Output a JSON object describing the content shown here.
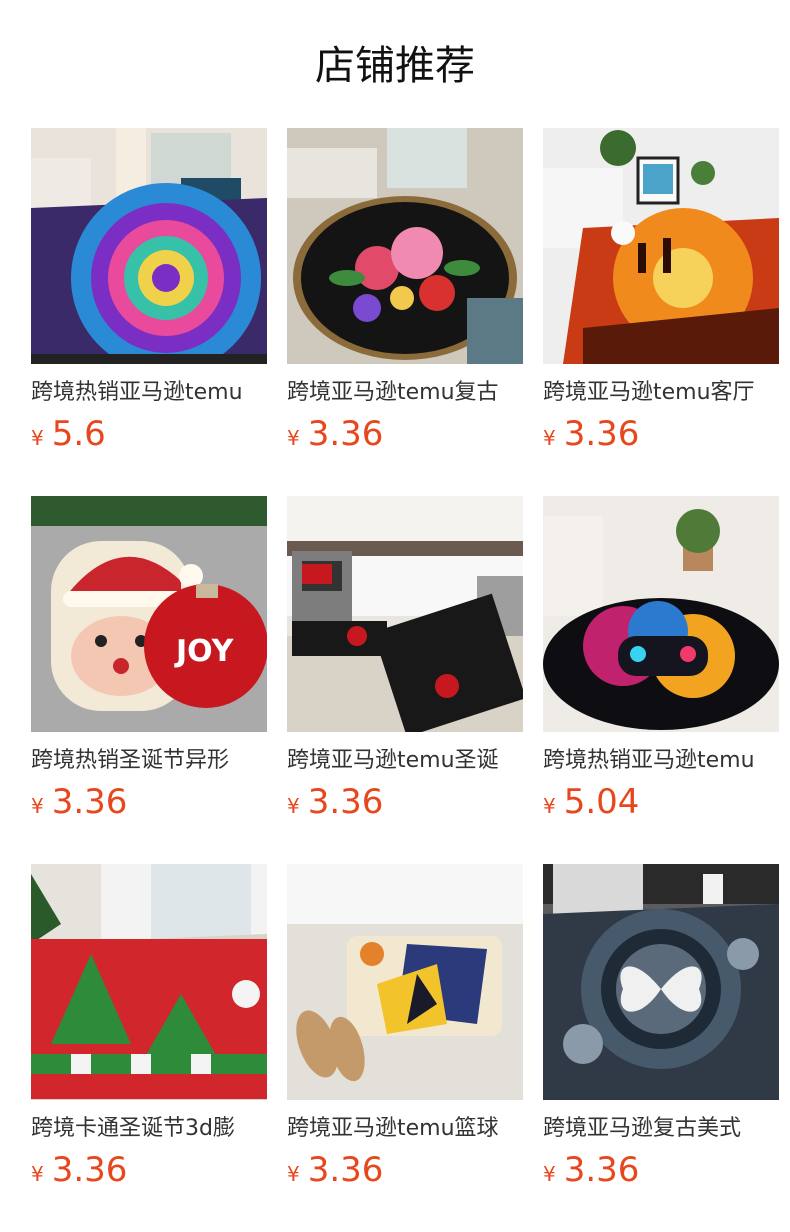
{
  "header": {
    "title": "店铺推荐"
  },
  "currency_symbol": "¥",
  "colors": {
    "price": "#e8461d",
    "text": "#333333"
  },
  "products": [
    {
      "name": "跨境热销亚马逊temu",
      "price": "5.6",
      "image": "psychedelic-mandala-rug"
    },
    {
      "name": "跨境亚马逊temu复古",
      "price": "3.36",
      "image": "floral-oval-rug"
    },
    {
      "name": "跨境亚马逊temu客厅",
      "price": "3.36",
      "image": "western-sunset-rug"
    },
    {
      "name": "跨境热销圣诞节异形",
      "price": "3.36",
      "image": "santa-joy-ornament-mats"
    },
    {
      "name": "跨境亚马逊temu圣诞",
      "price": "3.36",
      "image": "christmas-kitchen-runners"
    },
    {
      "name": "跨境热销亚马逊temu",
      "price": "5.04",
      "image": "gamepad-round-rug"
    },
    {
      "name": "跨境卡通圣诞节3d膨",
      "price": "3.36",
      "image": "merry-christmas-door-mat"
    },
    {
      "name": "跨境亚马逊temu篮球",
      "price": "3.36",
      "image": "basketball-bath-mat"
    },
    {
      "name": "跨境亚马逊复古美式",
      "price": "3.36",
      "image": "butterfly-gear-rug"
    }
  ]
}
